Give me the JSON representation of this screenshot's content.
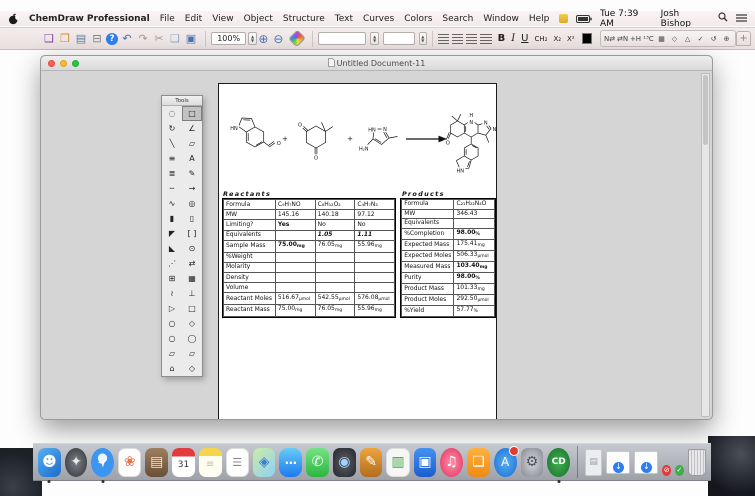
{
  "menu_bar": {
    "app_name": "ChemDraw Professional",
    "menus": [
      "File",
      "Edit",
      "View",
      "Object",
      "Structure",
      "Text",
      "Curves",
      "Colors",
      "Search",
      "Window",
      "Help"
    ],
    "time": "Tue 7:39 AM",
    "user": "Josh Bishop"
  },
  "toolbar": {
    "file_icons": [
      {
        "name": "new-document-icon",
        "glyph": "❑",
        "color": "#7b3fa0"
      },
      {
        "name": "open-document-icon",
        "glyph": "❒",
        "color": "#d98a2b"
      },
      {
        "name": "save-icon",
        "glyph": "▤",
        "color": "#5b7f9e"
      },
      {
        "name": "print-icon",
        "glyph": "⊟",
        "color": "#7a7a7a"
      },
      {
        "name": "help-icon",
        "glyph": "?",
        "color": "#fff",
        "bg": "#2f7ef0"
      },
      {
        "name": "undo-icon",
        "glyph": "↶",
        "color": "#3a6fc0"
      },
      {
        "name": "redo-icon",
        "glyph": "↷",
        "color": "#9a9a9a"
      },
      {
        "name": "cut-icon",
        "glyph": "✂",
        "color": "#9a9a9a"
      },
      {
        "name": "copy-icon",
        "glyph": "❏",
        "color": "#8fa8c8"
      },
      {
        "name": "paste-icon",
        "glyph": "▣",
        "color": "#4a76b8"
      }
    ],
    "zoom_value": "100%",
    "zoom_in_glyph": "⊕",
    "zoom_out_glyph": "⊖",
    "format": {
      "bold": "B",
      "italic": "I",
      "underline": "U",
      "formula": "CH₂",
      "subscript": "X₂",
      "superscript": "X²"
    },
    "chem_icons": [
      {
        "name": "name-to-structure-icon",
        "glyph": "N⇄"
      },
      {
        "name": "structure-to-name-icon",
        "glyph": "⇄N"
      },
      {
        "name": "implicit-hydrogens-icon",
        "glyph": "+H"
      },
      {
        "name": "nmr-predict-icon",
        "glyph": "¹³C"
      },
      {
        "name": "periodic-table-icon",
        "glyph": "▦"
      },
      {
        "name": "check-structure-icon",
        "glyph": "◇"
      },
      {
        "name": "clean-structure-icon",
        "glyph": "△"
      },
      {
        "name": "analyze-structure-icon",
        "glyph": "✓"
      },
      {
        "name": "revert-structure-icon",
        "glyph": "↺"
      },
      {
        "name": "expand-label-icon",
        "glyph": "⊕"
      }
    ],
    "add_button": "+"
  },
  "window": {
    "title": "Untitled Document-11"
  },
  "tools_palette": {
    "title": "Tools",
    "tools": [
      {
        "name": "lasso-select-tool",
        "glyph": "◌"
      },
      {
        "name": "marquee-select-tool",
        "glyph": "□",
        "selected": true
      },
      {
        "name": "rotate-tool",
        "glyph": "↻"
      },
      {
        "name": "arc-tool",
        "glyph": "∠"
      },
      {
        "name": "solid-bond-tool",
        "glyph": "╲"
      },
      {
        "name": "eraser-tool",
        "glyph": "▱"
      },
      {
        "name": "multiple-bond-tool",
        "glyph": "≡"
      },
      {
        "name": "text-tool",
        "glyph": "A"
      },
      {
        "name": "hashed-bond-tool",
        "glyph": "≣"
      },
      {
        "name": "pen-tool",
        "glyph": "✎"
      },
      {
        "name": "dashed-bond-tool",
        "glyph": "╌"
      },
      {
        "name": "arrow-tool",
        "glyph": "→"
      },
      {
        "name": "wavy-bond-tool",
        "glyph": "∿"
      },
      {
        "name": "orbital-tool",
        "glyph": "◎"
      },
      {
        "name": "bold-bond-tool",
        "glyph": "▮"
      },
      {
        "name": "rectangle-tool",
        "glyph": "▯"
      },
      {
        "name": "wedge-bond-tool",
        "glyph": "◤"
      },
      {
        "name": "bracket-tool",
        "glyph": "[ ]"
      },
      {
        "name": "hollow-wedge-tool",
        "glyph": "◣"
      },
      {
        "name": "circle-orbital-tool",
        "glyph": "⊙"
      },
      {
        "name": "query-bond-tool",
        "glyph": "⋰"
      },
      {
        "name": "atom-atom-map-tool",
        "glyph": "⇄"
      },
      {
        "name": "table-tool",
        "glyph": "⊞"
      },
      {
        "name": "template-tool",
        "glyph": "▦"
      },
      {
        "name": "curve-tool",
        "glyph": "≀"
      },
      {
        "name": "stamp-tool",
        "glyph": "⊥"
      },
      {
        "name": "triangle-shape-tool",
        "glyph": "▷"
      },
      {
        "name": "square-shape-tool",
        "glyph": "□"
      },
      {
        "name": "oval-shape-tool",
        "glyph": "○"
      },
      {
        "name": "hexagon-shape-tool",
        "glyph": "◇"
      },
      {
        "name": "circle-shape-tool",
        "glyph": "○"
      },
      {
        "name": "ring-shape-tool",
        "glyph": "◯"
      },
      {
        "name": "parallelogram-shape-tool",
        "glyph": "▱"
      },
      {
        "name": "trapezoid-shape-tool",
        "glyph": "▱"
      },
      {
        "name": "pentagon-shape-tool",
        "glyph": "⌂"
      },
      {
        "name": "polygon-shape-tool",
        "glyph": "◇"
      }
    ]
  },
  "scheme": {
    "labels": {
      "plus": "+",
      "s1_hn": "HN",
      "s1_o": "O",
      "s2_o1": "O",
      "s2_o2": "O",
      "s3_hn": "HN",
      "s3_n": "N",
      "s3_h2n": "H₂N",
      "p_h": "H",
      "p_n1": "N",
      "p_n2": "N",
      "p_nh": "NH",
      "p_o": "O",
      "p_hn": "HN"
    }
  },
  "table": {
    "reactants": {
      "header": "Reactants",
      "rows": [
        {
          "label": "Formula",
          "values": [
            {
              "v": "C₉H₇NO"
            },
            {
              "v": "C₈H₁₂O₂"
            },
            {
              "v": "C₄H₇N₃"
            }
          ]
        },
        {
          "label": "MW",
          "values": [
            {
              "v": "145.16"
            },
            {
              "v": "140.18"
            },
            {
              "v": "97.12"
            }
          ]
        },
        {
          "label": "Limiting?",
          "values": [
            {
              "v": "Yes",
              "b": true
            },
            {
              "v": "No"
            },
            {
              "v": "No"
            }
          ]
        },
        {
          "label": "Equivalents",
          "values": [
            {
              "v": ""
            },
            {
              "v": "1.05",
              "b": true,
              "i": true
            },
            {
              "v": "1.11",
              "b": true,
              "i": true
            }
          ]
        },
        {
          "label": "Sample Mass",
          "values": [
            {
              "v": "75.00",
              "u": "mg",
              "b": true
            },
            {
              "v": "76.05",
              "u": "mg"
            },
            {
              "v": "55.96",
              "u": "mg"
            }
          ]
        },
        {
          "label": "%Weight",
          "values": [
            {
              "v": ""
            },
            {
              "v": ""
            },
            {
              "v": ""
            }
          ]
        },
        {
          "label": "Molarity",
          "values": [
            {
              "v": ""
            },
            {
              "v": ""
            },
            {
              "v": ""
            }
          ]
        },
        {
          "label": "Density",
          "values": [
            {
              "v": ""
            },
            {
              "v": ""
            },
            {
              "v": ""
            }
          ]
        },
        {
          "label": "Volume",
          "values": [
            {
              "v": ""
            },
            {
              "v": ""
            },
            {
              "v": ""
            }
          ]
        },
        {
          "label": "Reactant Moles",
          "values": [
            {
              "v": "516.67",
              "u": "µmol"
            },
            {
              "v": "542.55",
              "u": "µmol"
            },
            {
              "v": "576.08",
              "u": "µmol"
            }
          ]
        },
        {
          "label": "Reactant Mass",
          "values": [
            {
              "v": "75.00",
              "u": "mg"
            },
            {
              "v": "76.05",
              "u": "mg"
            },
            {
              "v": "55.96",
              "u": "mg"
            }
          ]
        }
      ]
    },
    "products": {
      "header": "Products",
      "rows": [
        {
          "label": "Formula",
          "value": {
            "v": "C₂₁H₂₂N₄O"
          }
        },
        {
          "label": "MW",
          "value": {
            "v": "346.43"
          }
        },
        {
          "label": "Equivalents",
          "value": {
            "v": ""
          }
        },
        {
          "label": "%Completion",
          "value": {
            "v": "98.00",
            "u": "%",
            "b": true
          }
        },
        {
          "label": "Expected Mass",
          "value": {
            "v": "175.41",
            "u": "mg"
          }
        },
        {
          "label": "Expected Moles",
          "value": {
            "v": "506.33",
            "u": "µmol"
          }
        },
        {
          "label": "Measured Mass",
          "value": {
            "v": "103.40",
            "u": "mg",
            "b": true
          }
        },
        {
          "label": "Purity",
          "value": {
            "v": "98.00",
            "u": "%",
            "b": true
          }
        },
        {
          "label": "Product Mass",
          "value": {
            "v": "101.33",
            "u": "mg"
          }
        },
        {
          "label": "Product Moles",
          "value": {
            "v": "292.50",
            "u": "µmol"
          }
        },
        {
          "label": "%Yield",
          "value": {
            "v": "57.77",
            "u": "%"
          }
        }
      ]
    }
  },
  "dock": {
    "items": [
      {
        "name": "finder",
        "glyph": "☻",
        "running": true
      },
      {
        "name": "launchpad",
        "glyph": "✦"
      },
      {
        "name": "safari",
        "glyph": "➤",
        "running": true
      },
      {
        "name": "photos",
        "glyph": "❀"
      },
      {
        "name": "contacts",
        "glyph": "▤"
      },
      {
        "name": "calendar",
        "glyph": "31"
      },
      {
        "name": "notes",
        "glyph": "≡"
      },
      {
        "name": "reminders",
        "glyph": "☰"
      },
      {
        "name": "maps",
        "glyph": "◈"
      },
      {
        "name": "messages",
        "glyph": "…"
      },
      {
        "name": "facetime",
        "glyph": "✆"
      },
      {
        "name": "photo-booth",
        "glyph": "◉"
      },
      {
        "name": "pages",
        "glyph": "✎"
      },
      {
        "name": "numbers",
        "glyph": "▥"
      },
      {
        "name": "keynote",
        "glyph": "▣"
      },
      {
        "name": "itunes",
        "glyph": "♫"
      },
      {
        "name": "ibooks",
        "glyph": "❏"
      },
      {
        "name": "app-store",
        "glyph": "A"
      },
      {
        "name": "system-preferences",
        "glyph": "⚙"
      },
      {
        "name": "chemdraw",
        "glyph": "CD",
        "running": true
      },
      {
        "name": "separator"
      },
      {
        "name": "document",
        "glyph": "▤"
      },
      {
        "name": "downloads-1",
        "glyph": "↓"
      },
      {
        "name": "downloads-2",
        "glyph": "↓"
      },
      {
        "name": "badge-red",
        "glyph": "⊘",
        "mini": true
      },
      {
        "name": "badge-green",
        "glyph": "✓",
        "mini": true
      },
      {
        "name": "trash",
        "glyph": ""
      }
    ]
  }
}
